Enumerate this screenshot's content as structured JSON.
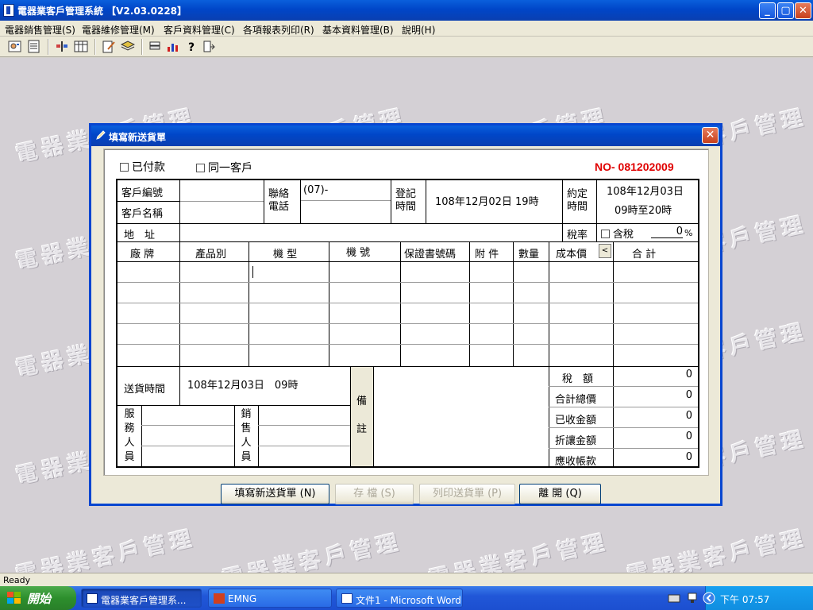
{
  "app": {
    "title": "電器業客戶管理系統 【V2.03.0228】",
    "window_buttons": {
      "minimize": "_",
      "maximize": "▢",
      "close": "✕"
    }
  },
  "menu": [
    "電器銷售管理(S)",
    "電器維修管理(M)",
    "客戶資料管理(C)",
    "各項報表列印(R)",
    "基本資料管理(B)",
    "說明(H)"
  ],
  "toolbar_icons": [
    "customer-card-icon",
    "document-list-icon",
    "scale-icon",
    "table-icon",
    "edit-icon",
    "book-icon",
    "stack-icon",
    "chart-icon",
    "help-icon",
    "exit-door-icon"
  ],
  "watermark": "電器業客戶管理",
  "dialog": {
    "title": "填寫新送貨單",
    "close": "✕",
    "paid_label": "已付款",
    "same_customer_label": "同一客戶",
    "order_no": "NO- 081202009",
    "customer_no_label": "客戶編號",
    "customer_name_label": "客戶名稱",
    "contact_phone_label": "聯絡電話",
    "phone_value": "(07)-",
    "register_time_label": "登記時間",
    "register_time_value": "108年12月02日  19時",
    "appointment_label": "約定時間",
    "appointment_date": "108年12月03日",
    "appointment_time": "09時至20時",
    "address_label": "地　址",
    "tax_rate_label": "稅率",
    "tax_included_label": "含稅",
    "tax_rate_value": "0",
    "percent": "%",
    "columns": [
      "廠 牌",
      "產品別",
      "機 型",
      "機 號",
      "保證書號碼",
      "附 件",
      "數量",
      "成本價",
      "合 計"
    ],
    "scroll_btn": "<",
    "delivery_time_label": "送貨時間",
    "delivery_time_value": "108年12月03日　09時",
    "service_staff_label": [
      "服",
      "務",
      "人",
      "員"
    ],
    "sales_staff_label": [
      "銷",
      "售",
      "人",
      "員"
    ],
    "remarks_label": [
      "備",
      "註"
    ],
    "summary": [
      {
        "label": "稅　額",
        "value": "0"
      },
      {
        "label": "合計總價",
        "value": "0"
      },
      {
        "label": "已收金額",
        "value": "0"
      },
      {
        "label": "折讓金額",
        "value": "0"
      },
      {
        "label": "應收帳款",
        "value": "0"
      }
    ],
    "buttons": {
      "new": "填寫新送貨單 (N)",
      "save": "存 檔 (S)",
      "print": "列印送貨單 (P)",
      "leave": "離 開 (Q)"
    }
  },
  "status": "Ready",
  "taskbar": {
    "start": "開始",
    "tasks": [
      "電器業客戶管理系...",
      "EMNG",
      "文件1 - Microsoft Word"
    ],
    "clock": "下午 07:57"
  }
}
